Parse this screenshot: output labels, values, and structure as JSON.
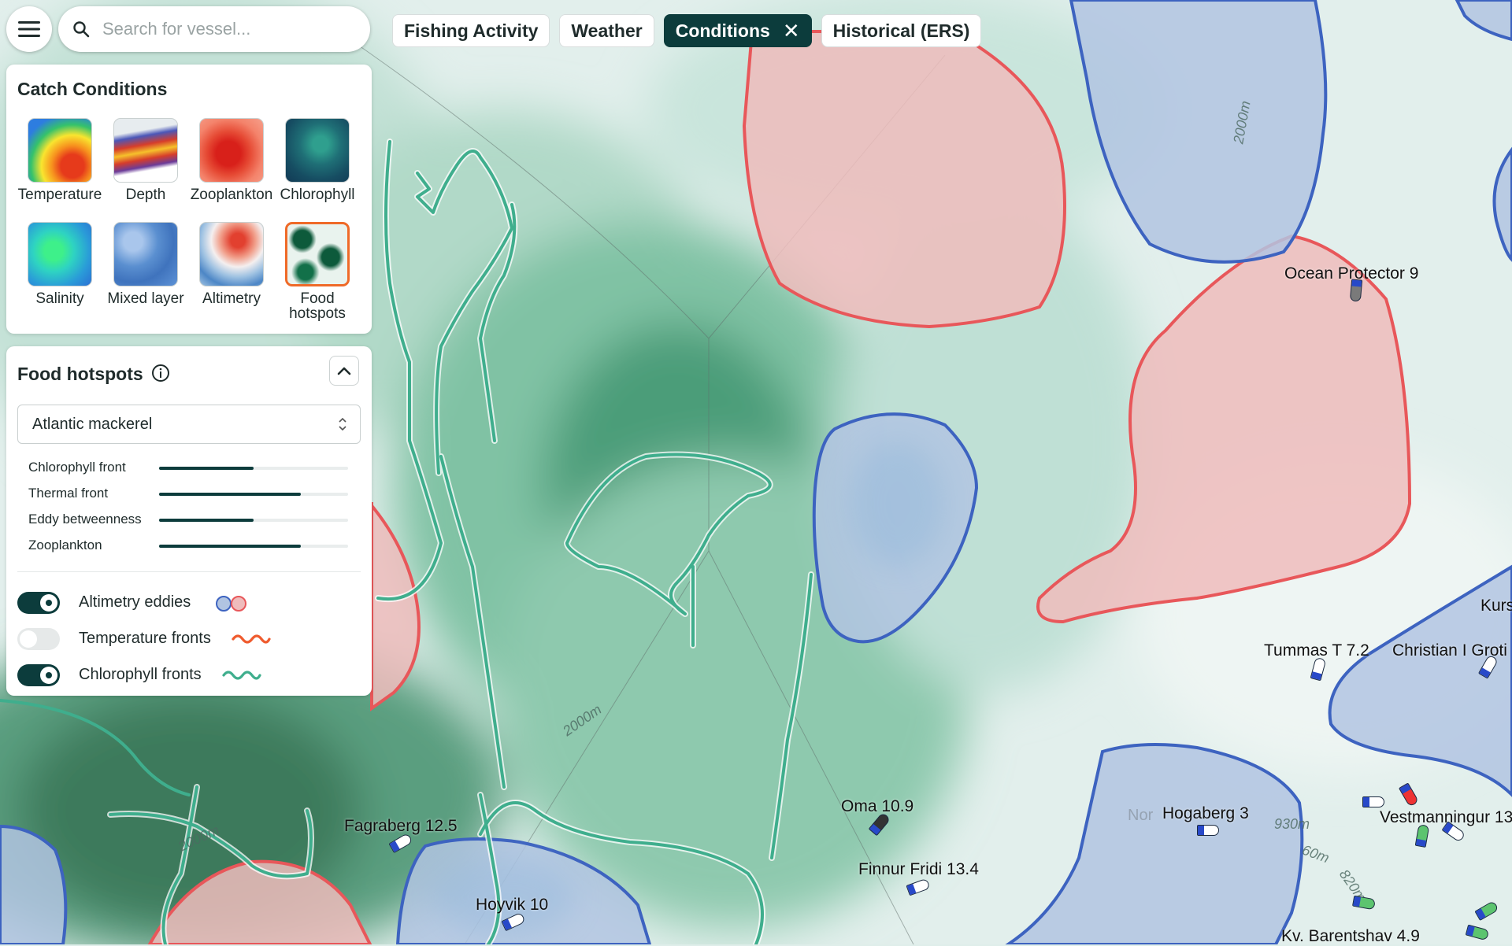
{
  "search": {
    "placeholder": "Search for vessel..."
  },
  "tabs": [
    {
      "label": "Fishing Activity",
      "active": false
    },
    {
      "label": "Weather",
      "active": false
    },
    {
      "label": "Conditions",
      "active": true
    },
    {
      "label": "Historical (ERS)",
      "active": false
    }
  ],
  "catch_conditions": {
    "title": "Catch Conditions",
    "layers": [
      {
        "label": "Temperature",
        "icon": "temperature-thumbnail"
      },
      {
        "label": "Depth",
        "icon": "depth-thumbnail"
      },
      {
        "label": "Zooplankton",
        "icon": "zooplankton-thumbnail"
      },
      {
        "label": "Chlorophyll",
        "icon": "chlorophyll-thumbnail"
      },
      {
        "label": "Salinity",
        "icon": "salinity-thumbnail"
      },
      {
        "label": "Mixed layer",
        "icon": "mixed-layer-thumbnail"
      },
      {
        "label": "Altimetry",
        "icon": "altimetry-thumbnail"
      },
      {
        "label": "Food hotspots",
        "icon": "food-hotspots-thumbnail",
        "selected": true
      }
    ]
  },
  "food_hotspots": {
    "title": "Food hotspots",
    "species": "Atlantic mackerel",
    "factors": [
      {
        "label": "Chlorophyll front",
        "level": 0.5
      },
      {
        "label": "Thermal front",
        "level": 0.75
      },
      {
        "label": "Eddy betweenness",
        "level": 0.5
      },
      {
        "label": "Zooplankton",
        "level": 0.75
      }
    ],
    "toggles": [
      {
        "label": "Altimetry eddies",
        "on": true
      },
      {
        "label": "Temperature fronts",
        "on": false
      },
      {
        "label": "Chlorophyll fronts",
        "on": true
      }
    ]
  },
  "map": {
    "contour_labels": [
      "2000m",
      "2000m",
      "2000m",
      "930m",
      "60m",
      "820m"
    ],
    "region_label": "Nor",
    "vessels": [
      {
        "name": "Ocean Protector 9"
      },
      {
        "name": "Tummas T 7.2"
      },
      {
        "name": "Christian I Groti"
      },
      {
        "name": "Kurs"
      },
      {
        "name": "Fagraberg 12.5"
      },
      {
        "name": "Oma 10.9"
      },
      {
        "name": "Finnur Fridi 13.4"
      },
      {
        "name": "Hoyvik 10"
      },
      {
        "name": "Hogaberg 3"
      },
      {
        "name": "Vestmanningur 13"
      },
      {
        "name": "Kv. Barentshav 4.9"
      }
    ],
    "colors": {
      "hotspot_red": "#e8575a",
      "eddy_blue": "#3d63c0",
      "chl_front": "#3fae8d",
      "accent": "#0c3c3c"
    }
  }
}
